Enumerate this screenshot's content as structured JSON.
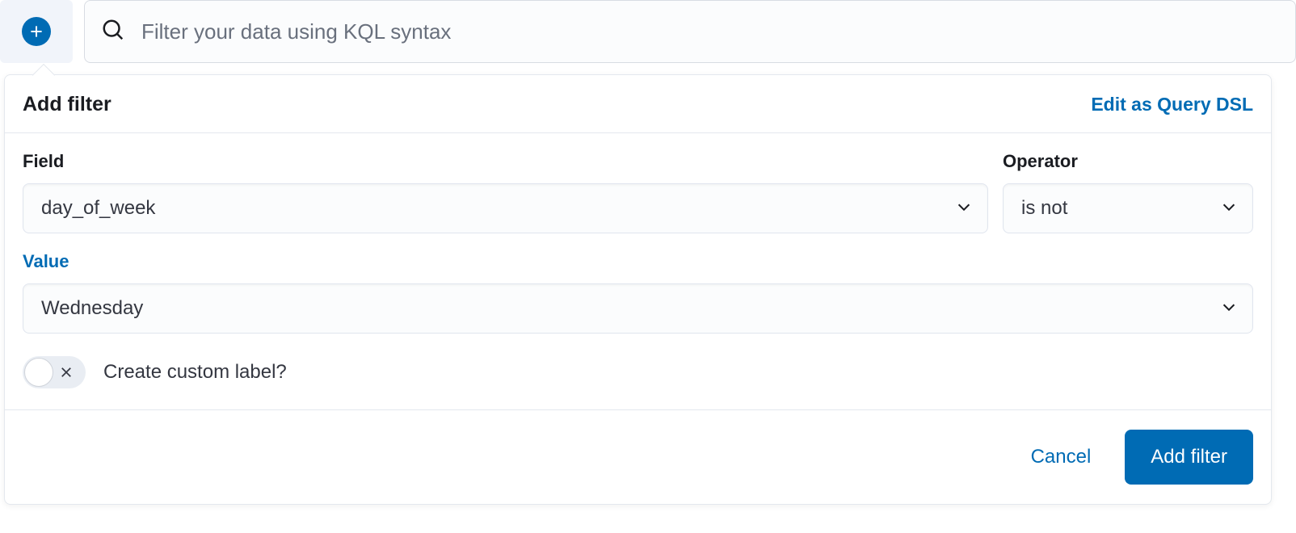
{
  "topbar": {
    "search_placeholder": "Filter your data using KQL syntax"
  },
  "popover": {
    "title": "Add filter",
    "edit_dsl_link": "Edit as Query DSL",
    "form": {
      "field_label": "Field",
      "field_value": "day_of_week",
      "operator_label": "Operator",
      "operator_value": "is not",
      "value_label": "Value",
      "value_value": "Wednesday",
      "custom_label_toggle": "Create custom label?",
      "custom_label_state": false
    },
    "footer": {
      "cancel_label": "Cancel",
      "submit_label": "Add filter"
    }
  }
}
